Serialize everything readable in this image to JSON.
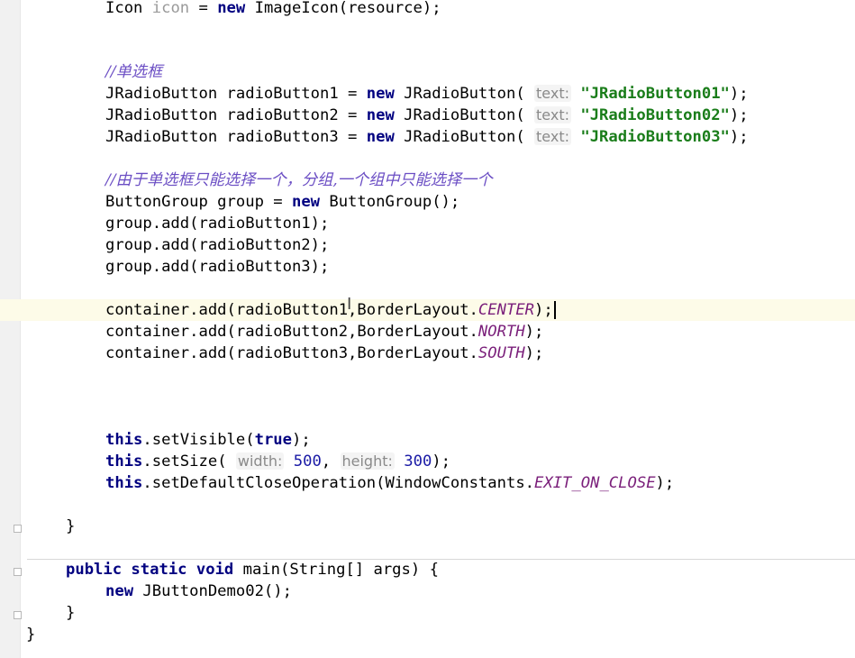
{
  "editor": {
    "lines": {
      "l1": {
        "a": "Icon ",
        "b": "icon",
        "c": " = ",
        "d": "new",
        "e": " ImageIcon(resource);"
      },
      "l2": {
        "a": "//单选框"
      },
      "l3": {
        "a": "JRadioButton radioButton1 = ",
        "b": "new",
        "c": " JRadioButton( ",
        "hint": "text:",
        "str": "\"JRadioButton01\"",
        "d": ");"
      },
      "l4": {
        "a": "JRadioButton radioButton2 = ",
        "b": "new",
        "c": " JRadioButton( ",
        "hint": "text:",
        "str": "\"JRadioButton02\"",
        "d": ");"
      },
      "l5": {
        "a": "JRadioButton radioButton3 = ",
        "b": "new",
        "c": " JRadioButton( ",
        "hint": "text:",
        "str": "\"JRadioButton03\"",
        "d": ");"
      },
      "l6": {
        "a": "//由于单选框只能选择一个，分组,一个组中只能选择一个"
      },
      "l7": {
        "a": "ButtonGroup group = ",
        "b": "new",
        "c": " ButtonGroup();"
      },
      "l8": {
        "a": "group.add(radioButton1);"
      },
      "l9": {
        "a": "group.add(radioButton2);"
      },
      "l10": {
        "a": "group.add(radioButton3);"
      },
      "l11": {
        "a": "container.add(radioButton1,BorderLayout.",
        "b": "CENTER",
        "c": ");"
      },
      "l12": {
        "a": "container.add(radioButton2,BorderLayout.",
        "b": "NORTH",
        "c": ");"
      },
      "l13": {
        "a": "container.add(radioButton3,BorderLayout.",
        "b": "SOUTH",
        "c": ");"
      },
      "l14": {
        "a": "this",
        "b": ".setVisible(",
        "c": "true",
        "d": ");"
      },
      "l15": {
        "a": "this",
        "b": ".setSize( ",
        "h1": "width:",
        "n1": "500",
        "c": ", ",
        "h2": "height:",
        "n2": "300",
        "d": ");"
      },
      "l16": {
        "a": "this",
        "b": ".setDefaultCloseOperation(WindowConstants.",
        "c": "EXIT_ON_CLOSE",
        "d": ");"
      },
      "l17": {
        "a": "}"
      },
      "l18": {
        "a": "public static void",
        "b": " main(String[] args) {"
      },
      "l19": {
        "a": "new",
        "b": " JButtonDemo02();"
      },
      "l20": {
        "a": "}"
      },
      "l21": {
        "a": "}"
      }
    },
    "colors": {
      "keyword": "#000080",
      "comment": "#6b4ec4",
      "string": "#1a7d1a",
      "number": "#1a1aa6",
      "constant": "#7a1f7a",
      "current_line": "#fdfbe8"
    }
  }
}
